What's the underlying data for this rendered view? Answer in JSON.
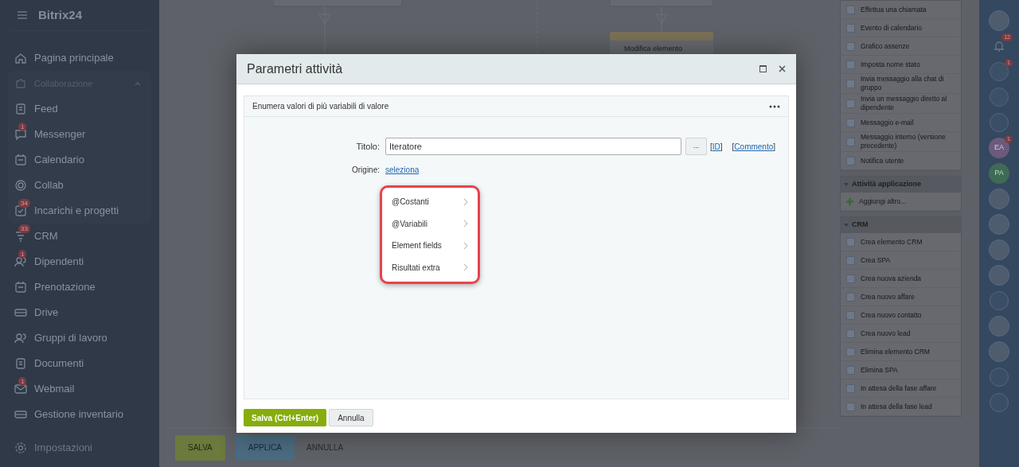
{
  "sidebar": {
    "logo": "Bitrix24",
    "items": [
      {
        "label": "Pagina principale"
      },
      {
        "label": "Collaborazione",
        "expanded": true,
        "children": [
          {
            "label": "Feed"
          },
          {
            "label": "Messenger",
            "badge": "1"
          },
          {
            "label": "Calendario"
          },
          {
            "label": "Collab"
          },
          {
            "label": "Incarichi e progetti",
            "badge": "34"
          }
        ]
      },
      {
        "label": "CRM",
        "badge": "33"
      },
      {
        "label": "Dipendenti",
        "badge": "1"
      },
      {
        "label": "Prenotazione"
      },
      {
        "label": "Drive"
      },
      {
        "label": "Gruppi di lavoro"
      },
      {
        "label": "Documenti"
      },
      {
        "label": "Webmail",
        "badge": "1"
      },
      {
        "label": "Gestione inventario"
      }
    ],
    "settings": "Impostazioni"
  },
  "canvas": {
    "node_title": "Modifica elemento",
    "bottom_bar": {
      "buttons": [
        {
          "label": "SALVA",
          "kind": "primary"
        },
        {
          "label": "APPLICA",
          "kind": "secondary"
        },
        {
          "label": "ANNULLA",
          "kind": "link"
        }
      ]
    }
  },
  "activity_panel": {
    "sections": [
      {
        "items": [
          "Effettua una chiamata",
          "Evento di calendario",
          "Grafico assenze",
          "Imposta nome stato",
          "Invia messaggio alla chat di gruppo",
          "Invia un messaggio diretto al dipendente",
          "Messaggio e-mail",
          "Messaggio interno (versione precedente)",
          "Notifica utente"
        ]
      },
      {
        "title": "Attività applicazione",
        "items": [
          "Aggiungi altro..."
        ]
      },
      {
        "title": "CRM",
        "items": [
          "Crea elemento CRM",
          "Crea SPA",
          "Crea nuova azienda",
          "Crea nuovo affare",
          "Crea nuovo contatto",
          "Crea nuovo lead",
          "Elimina elemento CRM",
          "Elimina SPA",
          "In attesa della fase affare",
          "In attesa della fase lead"
        ]
      }
    ]
  },
  "right_bar": {
    "items": [
      {
        "kind": "avatar"
      },
      {
        "kind": "bell",
        "badge": "12"
      },
      {
        "kind": "icon",
        "badge": "1"
      },
      {
        "kind": "icon"
      },
      {
        "kind": "circle"
      },
      {
        "kind": "initials",
        "text": "EA",
        "badge": "1"
      },
      {
        "kind": "initials",
        "text": "PA"
      },
      {
        "kind": "avatar"
      },
      {
        "kind": "avatar"
      },
      {
        "kind": "avatar"
      },
      {
        "kind": "avatar"
      },
      {
        "kind": "circle"
      },
      {
        "kind": "avatar"
      },
      {
        "kind": "avatar"
      },
      {
        "kind": "circle"
      },
      {
        "kind": "circle"
      }
    ]
  },
  "dialog": {
    "title": "Parametri attività",
    "subtitle": "Enumera valori di più variabili di valore",
    "title_field": {
      "label": "Titolo:",
      "value": "Iteratore",
      "button": "...",
      "links": [
        "[ID]",
        "[Commento]"
      ]
    },
    "origin": {
      "label": "Origine:",
      "link": "seleziona"
    },
    "menu": [
      "@Costanti",
      "@Variabili",
      "Element fields",
      "Risultati extra"
    ],
    "buttons": [
      {
        "label": "Salva (Ctrl+Enter)",
        "kind": "primary"
      },
      {
        "label": "Annulla",
        "kind": "secondary"
      }
    ]
  }
}
